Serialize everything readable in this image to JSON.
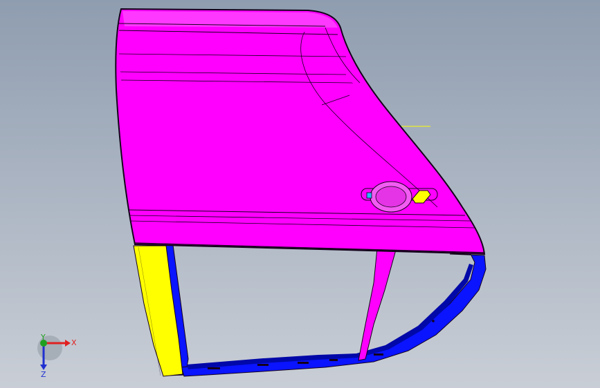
{
  "viewport": {
    "background_top": "#8f9db0",
    "background_bottom": "#c9ced6"
  },
  "model": {
    "outer_panel_color": "#ff00ff",
    "outer_panel_shade": "#d600d6",
    "inner_frame_color": "#0a14ff",
    "inner_frame_shade": "#0008a8",
    "seal_strip_color": "#ffff00",
    "edge_color": "#14001a",
    "handle_pocket_color": "#ffff00",
    "handle_marker_color": "#29b6f6"
  },
  "triad": {
    "x_label": "X",
    "y_label": "Y",
    "z_label": "Z",
    "x_color": "#e02020",
    "y_color": "#20a020",
    "z_color": "#2030d0"
  }
}
